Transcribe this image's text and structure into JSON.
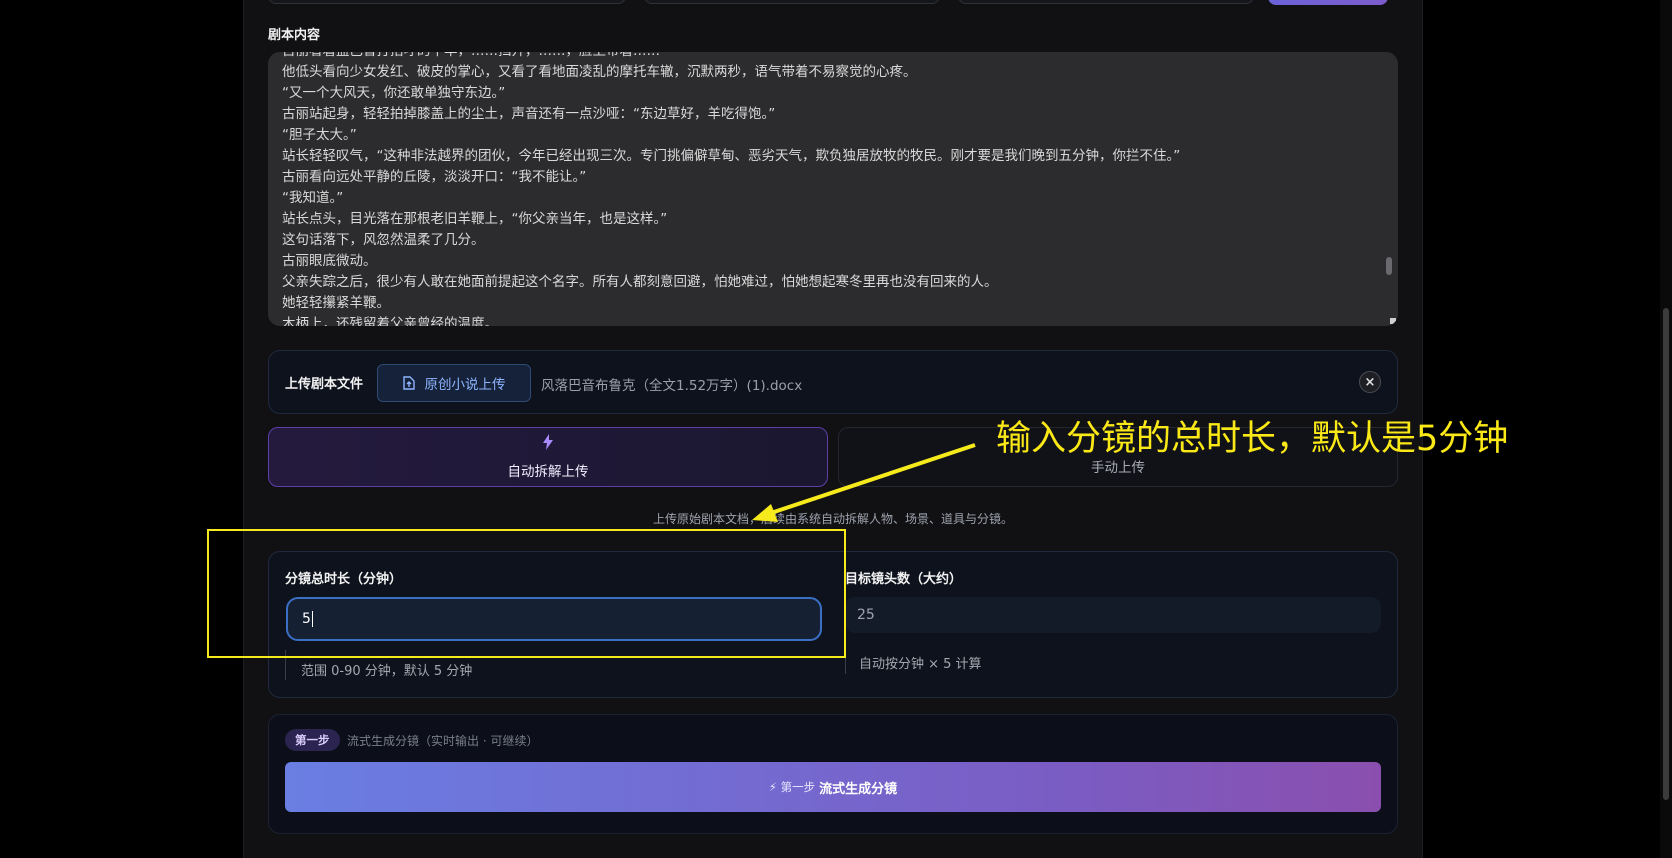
{
  "script_section": {
    "label": "剧本内容",
    "lines": [
      "古丽看着盖巴音打招呼的牛羊，……挡开，……，脸上带着……",
      "他低头看向少女发红、破皮的掌心，又看了看地面凌乱的摩托车辙，沉默两秒，语气带着不易察觉的心疼。",
      "“又一个大风天，你还敢单独守东边。”",
      "古丽站起身，轻轻拍掉膝盖上的尘土，声音还有一点沙哑：“东边草好，羊吃得饱。”",
      "“胆子太大。”",
      "站长轻轻叹气，“这种非法越界的团伙，今年已经出现三次。专门挑偏僻草甸、恶劣天气，欺负独居放牧的牧民。刚才要是我们晚到五分钟，你拦不住。”",
      "古丽看向远处平静的丘陵，淡淡开口：“我不能让。”",
      "“我知道。”",
      "站长点头，目光落在那根老旧羊鞭上，“你父亲当年，也是这样。”",
      "这句话落下，风忽然温柔了几分。",
      "古丽眼底微动。",
      "父亲失踪之后，很少有人敢在她面前提起这个名字。所有人都刻意回避，怕她难过，怕她想起寒冬里再也没有回来的人。",
      "她轻轻攥紧羊鞭。",
      "木柄上，还残留着父亲曾经的温度。"
    ]
  },
  "upload": {
    "label": "上传剧本文件",
    "button_label": "原创小说上传",
    "file_name": "风落巴音布鲁克（全文1.52万字）(1).docx",
    "remove_label": "×"
  },
  "modes": {
    "auto_label": "自动拆解上传",
    "manual_label": "手动上传",
    "hint": "上传原始剧本文档，后续由系统自动拆解人物、场景、道具与分镜。"
  },
  "duration": {
    "label": "分镜总时长（分钟）",
    "value": "5",
    "note": "范围 0-90 分钟，默认 5 分钟"
  },
  "shots": {
    "label": "目标镜头数（大约）",
    "value": "25",
    "note": "自动按分钟 × 5 计算"
  },
  "step": {
    "badge": "第一步",
    "description": "流式生成分镜（实时输出 · 可继续）",
    "button_prefix": "⚡ 第一步",
    "button_label": "流式生成分镜"
  },
  "annotation": {
    "text": "输入分镜的总时长，默认是5分钟",
    "color": "#f6ea1c"
  },
  "colors": {
    "accent_purple": "#7d5ccc",
    "accent_blue": "#3a6fc4",
    "annotation_yellow": "#f6ea1c"
  }
}
